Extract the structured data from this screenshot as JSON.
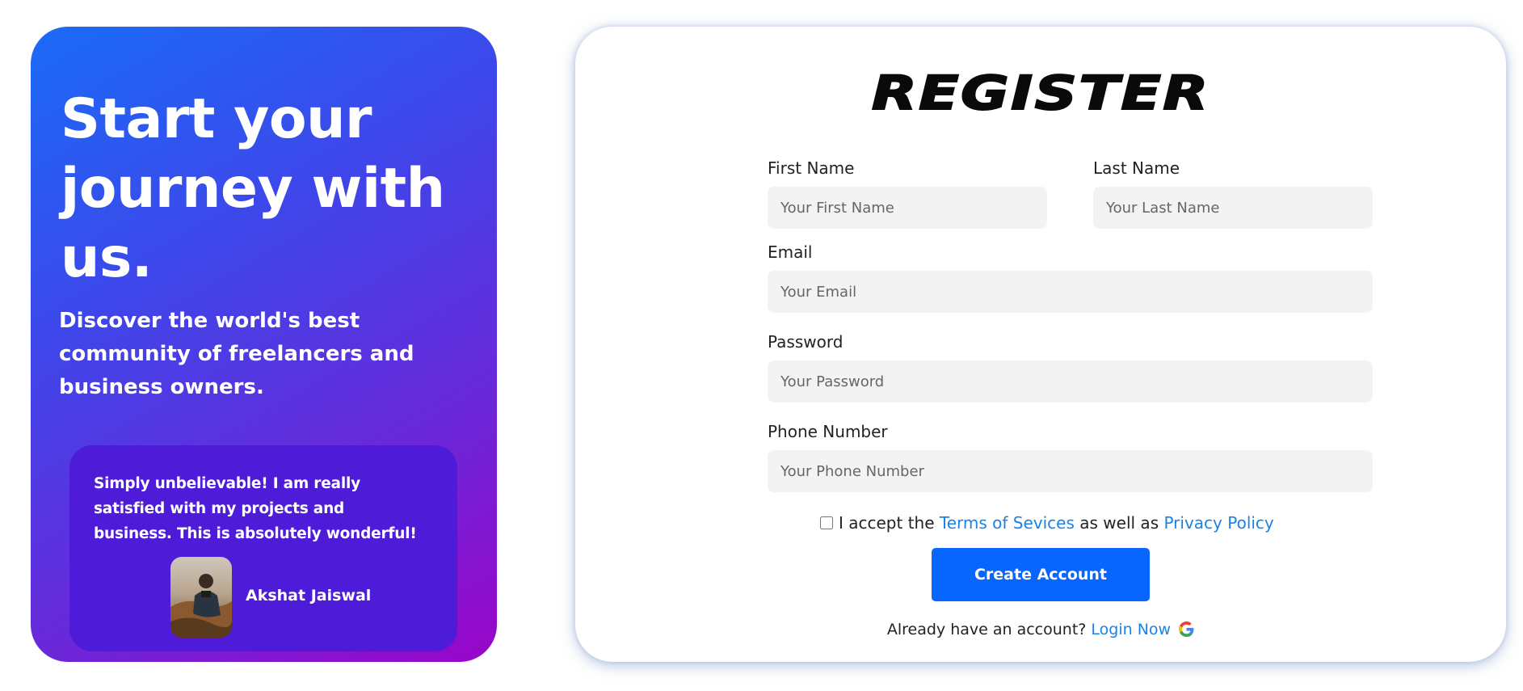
{
  "hero": {
    "title": "Start your journey with us.",
    "subtitle": "Discover the world's best community of freelancers and business owners.",
    "testimonial": {
      "quote": "Simply unbelievable! I am really satisfied with my projects and business. This is absolutely wonderful!",
      "author": "Akshat Jaiswal"
    }
  },
  "form": {
    "heading": "REGISTER",
    "fields": {
      "first_name": {
        "label": "First Name",
        "placeholder": "Your First Name",
        "value": ""
      },
      "last_name": {
        "label": "Last Name",
        "placeholder": "Your Last Name",
        "value": ""
      },
      "email": {
        "label": "Email",
        "placeholder": "Your Email",
        "value": ""
      },
      "password": {
        "label": "Password",
        "placeholder": "Your Password",
        "value": ""
      },
      "phone": {
        "label": "Phone Number",
        "placeholder": "Your Phone Number",
        "value": ""
      }
    },
    "terms": {
      "prefix": "I accept the",
      "terms_link": "Terms of Sevices",
      "middle": "as well as",
      "privacy_link": "Privacy Policy",
      "checked": false
    },
    "submit_label": "Create Account",
    "login_prompt": "Already have an account?",
    "login_link": "Login Now",
    "login_icon": "google-icon"
  },
  "colors": {
    "gradient_start": "#1a6cf7",
    "gradient_end": "#9a05c8",
    "testimonial_bg": "#4e1cd8",
    "button": "#0866ff",
    "link": "#1a82e6",
    "input_bg": "#f3f3f3"
  }
}
